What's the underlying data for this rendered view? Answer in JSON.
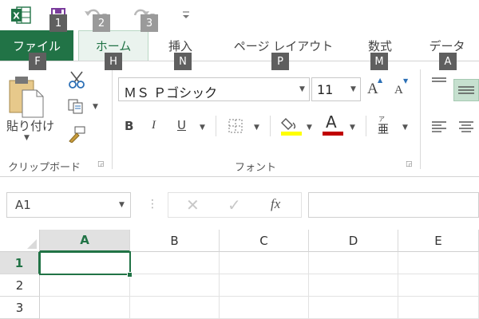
{
  "qat": {
    "keytips": [
      "1",
      "2",
      "3"
    ]
  },
  "tabs": [
    {
      "label": "ファイル",
      "keytip": "F"
    },
    {
      "label": "ホーム",
      "keytip": "H"
    },
    {
      "label": "挿入",
      "keytip": "N"
    },
    {
      "label": "ページ レイアウト",
      "keytip": "P"
    },
    {
      "label": "数式",
      "keytip": "M"
    },
    {
      "label": "データ",
      "keytip": "A"
    }
  ],
  "clipboard": {
    "paste_label": "貼り付け",
    "group_label": "クリップボード"
  },
  "font": {
    "family": "ＭＳ Ｐゴシック",
    "size": "11",
    "bold": "B",
    "italic": "I",
    "underline": "U",
    "font_color_glyph": "A",
    "grow_glyph": "A",
    "shrink_glyph": "A",
    "group_label": "フォント"
  },
  "formula_bar": {
    "name_box": "A1",
    "fx": "fx"
  },
  "sheet": {
    "columns": [
      "A",
      "B",
      "C",
      "D",
      "E"
    ],
    "rows": [
      "1",
      "2",
      "3"
    ]
  },
  "colors": {
    "accent": "#217346",
    "fill_highlight": "#ffff00",
    "font_red": "#c00000"
  }
}
